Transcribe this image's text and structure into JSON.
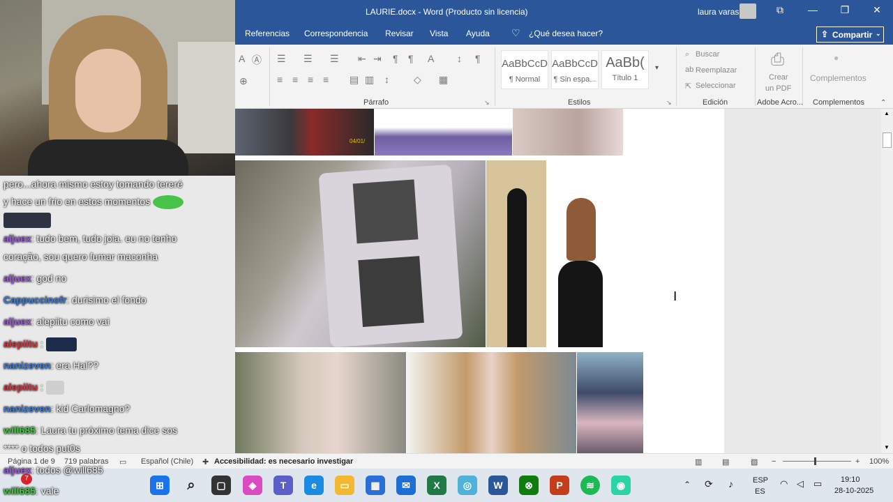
{
  "word": {
    "title": "LAURIE.docx  -  Word (Producto sin licencia)",
    "user": "laura varas",
    "window_buttons": [
      "—",
      "❐",
      "✕"
    ],
    "tabs": [
      "Referencias",
      "Correspondencia",
      "Revisar",
      "Vista",
      "Ayuda",
      "¿Qué desea hacer?"
    ],
    "share_label": "Compartir",
    "groups": {
      "paragraph": "Párrafo",
      "styles": "Estilos",
      "editing": "Edición",
      "adobe": "Adobe Acro...",
      "addins": "Complementos"
    },
    "styles_gallery": [
      {
        "sample": "AaBbCcD",
        "name": "¶ Normal"
      },
      {
        "sample": "AaBbCcD",
        "name": "¶ Sin espa..."
      },
      {
        "sample": "AaBb(",
        "name": "Título 1"
      }
    ],
    "editing": {
      "find": "Buscar",
      "replace": "Reemplazar",
      "select": "Seleccionar"
    },
    "adobe": {
      "line1": "Crear",
      "line2": "un PDF"
    },
    "addins_button": "Complementos"
  },
  "photo_stamp": "04/01/",
  "statusbar": {
    "page": "Página 1 de 9",
    "words": "719 palabras",
    "language": "Español (Chile)",
    "accessibility": "Accesibilidad: es necesario investigar",
    "zoom": "100%"
  },
  "chat": [
    {
      "user": "",
      "text": "pero...ahora mismo estoy tomando tereré",
      "color": "#ffffff"
    },
    {
      "user": "",
      "text": "y hace un frio en estos momentos",
      "color": "#ffffff"
    },
    {
      "user": "aljuex",
      "text": ": tudo bem, tudo joia. eu no tenho",
      "color": "#9b59d6"
    },
    {
      "user": "",
      "text": "coração, sou quero fumar maconha",
      "color": "#ffffff"
    },
    {
      "user": "aljuex",
      "text": ": god no",
      "color": "#9b59d6"
    },
    {
      "user": "Cappuccinofr",
      "text": ": durisimo el fondo",
      "color": "#3a7bd5"
    },
    {
      "user": "aljuex",
      "text": ": alepiitu como vai",
      "color": "#9b59d6"
    },
    {
      "user": "alepiitu",
      "text": ":",
      "color": "#e0303a"
    },
    {
      "user": "nanizeven",
      "text": ": era Hal??",
      "color": "#3a7bd5"
    },
    {
      "user": "alepiitu",
      "text": ":",
      "color": "#e0303a"
    },
    {
      "user": "nanizeven",
      "text": ": kid Carlomagno?",
      "color": "#3a7bd5"
    },
    {
      "user": "will685",
      "text": ": Laura tu próximo tema dice sos",
      "color": "#43c943"
    },
    {
      "user": "",
      "text": "**** o todos put0s",
      "color": "#ffffff"
    },
    {
      "user": "aljuex",
      "text": ": todos @will685",
      "color": "#9b59d6"
    },
    {
      "user": "will685",
      "text": ": vale",
      "color": "#43c943"
    }
  ],
  "taskbar": {
    "lang": "ESP",
    "lang2": "ES",
    "time": "19:10",
    "date": "28-10-2025",
    "badge": "7"
  }
}
